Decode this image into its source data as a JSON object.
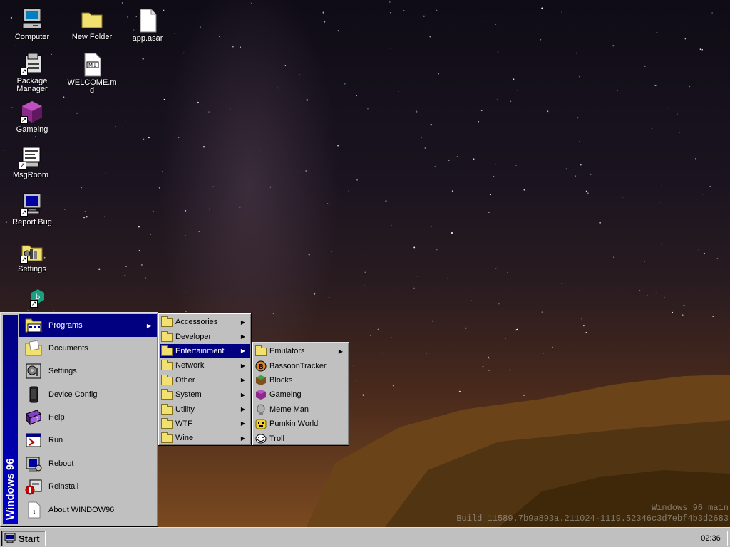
{
  "desktop_icons": [
    {
      "label": "Computer",
      "icon": "computer-icon"
    },
    {
      "label": "New Folder",
      "icon": "folder-icon"
    },
    {
      "label": "app.asar",
      "icon": "file-icon"
    },
    {
      "label": "Package Manager",
      "icon": "package-icon"
    },
    {
      "label": "WELCOME.md",
      "icon": "markdown-file-icon"
    },
    {
      "label": "Gameing",
      "icon": "game-cube-icon"
    },
    {
      "label": "MsgRoom",
      "icon": "chat-icon"
    },
    {
      "label": "Report Bug",
      "icon": "monitor-icon"
    },
    {
      "label": "Settings",
      "icon": "settings-folder-icon"
    }
  ],
  "watermark": {
    "line1": "Windows 96 main",
    "line2": "Build 11589.7b9a893a.211024-1119.52346c3d7ebf4b3d2683"
  },
  "start_menu": {
    "brand": "Windows 96",
    "items": [
      {
        "label": "Programs",
        "icon": "programs-icon",
        "has_submenu": true,
        "selected": true
      },
      {
        "label": "Documents",
        "icon": "documents-folder-icon"
      },
      {
        "label": "Settings",
        "icon": "settings-icon"
      },
      {
        "label": "Device Config",
        "icon": "device-icon"
      },
      {
        "label": "Help",
        "icon": "help-book-icon"
      },
      {
        "label": "Run",
        "icon": "run-icon"
      },
      {
        "label": "Reboot",
        "icon": "reboot-icon"
      },
      {
        "label": "Reinstall",
        "icon": "reinstall-icon"
      },
      {
        "label": "About WINDOW96",
        "icon": "about-icon"
      }
    ]
  },
  "programs_menu": [
    {
      "label": "Accessories"
    },
    {
      "label": "Developer"
    },
    {
      "label": "Entertainment",
      "selected": true
    },
    {
      "label": "Network"
    },
    {
      "label": "Other"
    },
    {
      "label": "System"
    },
    {
      "label": "Utility"
    },
    {
      "label": "WTF"
    },
    {
      "label": "Wine"
    }
  ],
  "entertainment_menu": [
    {
      "label": "Emulators",
      "icon": "folder-icon",
      "has_submenu": true
    },
    {
      "label": "BassoonTracker",
      "icon": "bassoon-icon"
    },
    {
      "label": "Blocks",
      "icon": "blocks-icon"
    },
    {
      "label": "Gameing",
      "icon": "game-cube-icon"
    },
    {
      "label": "Meme Man",
      "icon": "meme-man-icon"
    },
    {
      "label": "Pumkin World",
      "icon": "pumpkin-icon"
    },
    {
      "label": "Troll",
      "icon": "troll-face-icon"
    }
  ],
  "taskbar": {
    "start_label": "Start",
    "clock": "02:36"
  }
}
